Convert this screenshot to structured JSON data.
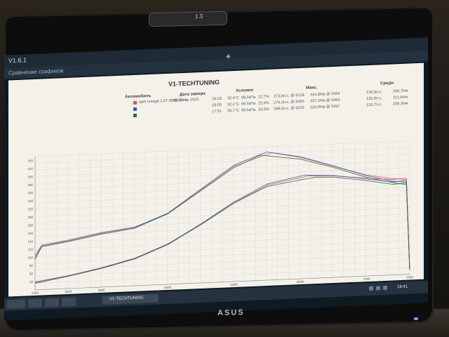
{
  "monitor": {
    "brand": "ASUS",
    "webcam_label": "1.3"
  },
  "app": {
    "title": "V1.6.1",
    "menu_text": "Сравнение графиков"
  },
  "sheet": {
    "title": "V1-TECHTUNING",
    "headers": {
      "car": "Автомобиль",
      "date": "Дата замера",
      "conditions": "Условия",
      "max": "Макс.",
      "avg": "Средн."
    },
    "rows": [
      {
        "color": "#e05060",
        "car": "opel omega 2.0T 8886 EX 1",
        "date": "08 Июнь 2015",
        "time": "18:18",
        "temp": "32,4°C",
        "pressure": "99,5кПа",
        "humidity": "22,7%",
        "power": "273,8л.с. @ 6128",
        "torque": "334,8Нм @ 5564",
        "avg_power": "130,8л.с.",
        "avg_torque": "206,7Нм"
      },
      {
        "color": "#3a5ab8",
        "car": "",
        "date": "",
        "time": "18:05",
        "temp": "32,2°C",
        "pressure": "99,5кПа",
        "humidity": "22,8%",
        "power": "276,0л.с. @ 6065",
        "torque": "337,2Нм @ 5494",
        "avg_power": "135,9л.с.",
        "avg_torque": "211,9Нм"
      },
      {
        "color": "#2f6a3a",
        "car": "",
        "date": "",
        "time": "17:51",
        "temp": "30,7°C",
        "pressure": "99,5кПа",
        "humidity": "24,5%",
        "power": "269,8л.с. @ 6220",
        "torque": "329,9Нм @ 5397",
        "avg_power": "133,7л.с.",
        "avg_torque": "208,3Нм"
      }
    ]
  },
  "chart_data": {
    "type": "line",
    "title": "",
    "xlabel": "",
    "ylabel": "",
    "x_ticks": [
      "2000",
      "2500",
      "3000",
      "4000",
      "5000",
      "6000",
      "7000",
      "7650"
    ],
    "y_ticks": [
      "40",
      "60",
      "80",
      "100",
      "120",
      "140",
      "160",
      "180",
      "200",
      "220",
      "240",
      "260",
      "280",
      "300",
      "320",
      "340"
    ],
    "xlim": [
      2000,
      7650
    ],
    "ylim": [
      20,
      350
    ],
    "grid": true,
    "series": [
      {
        "color": "#e05060",
        "x": [
          2000,
          2100,
          2500,
          3000,
          3500,
          4000,
          4500,
          5000,
          5564,
          6000,
          6500,
          7000,
          7400,
          7600,
          7650
        ],
        "y": [
          105,
          130,
          140,
          155,
          165,
          195,
          250,
          305,
          334.8,
          320,
          295,
          270,
          258,
          255,
          30
        ]
      },
      {
        "color": "#3a5ab8",
        "x": [
          2000,
          2100,
          2500,
          3000,
          3500,
          4000,
          4500,
          5000,
          5494,
          6000,
          6500,
          7000,
          7400,
          7600,
          7650
        ],
        "y": [
          100,
          128,
          138,
          153,
          164,
          196,
          252,
          308,
          337.2,
          322,
          296,
          268,
          252,
          248,
          30
        ]
      },
      {
        "color": "#2f6a3a",
        "x": [
          2000,
          2100,
          2500,
          3000,
          3500,
          4000,
          4500,
          5000,
          5397,
          6000,
          6500,
          7000,
          7400,
          7600,
          7650
        ],
        "y": [
          95,
          126,
          136,
          151,
          162,
          194,
          248,
          302,
          329.9,
          316,
          292,
          264,
          248,
          242,
          30
        ]
      },
      {
        "color": "#e05060",
        "x": [
          2000,
          2500,
          3000,
          3500,
          4000,
          4500,
          5000,
          5500,
          6128,
          6500,
          7000,
          7400,
          7600,
          7650
        ],
        "y": [
          40,
          52,
          68,
          88,
          120,
          165,
          215,
          255,
          273.8,
          271,
          262,
          256,
          258,
          30
        ]
      },
      {
        "color": "#3a5ab8",
        "x": [
          2000,
          2500,
          3000,
          3500,
          4000,
          4500,
          5000,
          5500,
          6065,
          6500,
          7000,
          7400,
          7600,
          7650
        ],
        "y": [
          38,
          51,
          67,
          87,
          119,
          166,
          217,
          258,
          276.0,
          272,
          260,
          250,
          252,
          30
        ]
      },
      {
        "color": "#2f6a3a",
        "x": [
          2000,
          2500,
          3000,
          3500,
          4000,
          4500,
          5000,
          5500,
          6220,
          6500,
          7000,
          7400,
          7600,
          7650
        ],
        "y": [
          36,
          50,
          66,
          86,
          118,
          164,
          214,
          252,
          269.8,
          268,
          256,
          244,
          246,
          30
        ]
      }
    ]
  },
  "taskbar": {
    "task_label": "V1-TECHTUNING",
    "clock": "18:41"
  }
}
